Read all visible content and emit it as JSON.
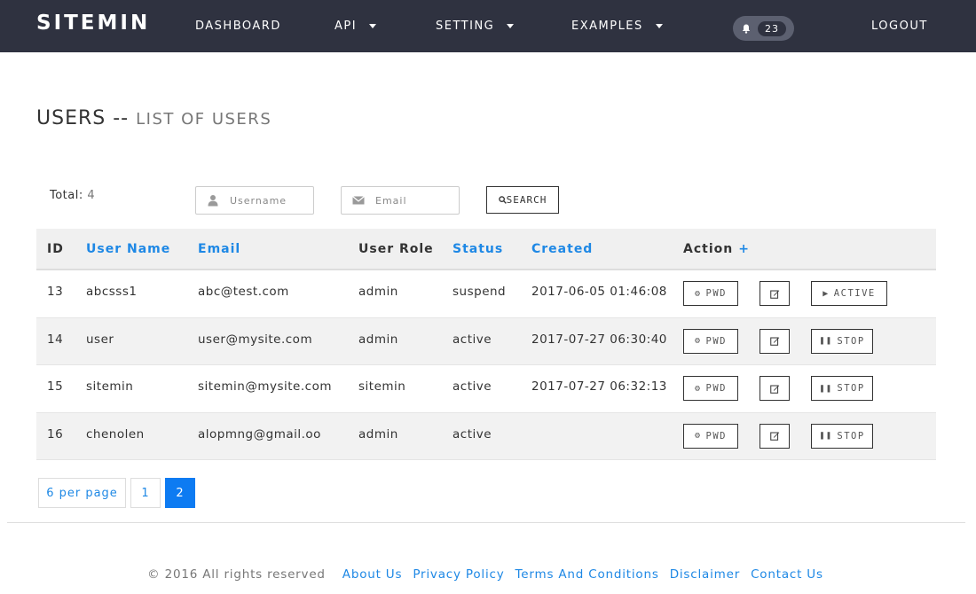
{
  "navbar": {
    "brand": "SITEMIN",
    "items": [
      {
        "label": "DASHBOARD",
        "dropdown": false
      },
      {
        "label": "API",
        "dropdown": true
      },
      {
        "label": "SETTING",
        "dropdown": true
      },
      {
        "label": "EXAMPLES",
        "dropdown": true
      }
    ],
    "notification_count": "23",
    "logout_label": "LOGOUT",
    "bg_color": "#2f3240"
  },
  "page": {
    "title": "USERS",
    "separator": "--",
    "subtitle": "LIST OF USERS"
  },
  "filters": {
    "total_label": "Total:",
    "total_value": "4",
    "username_placeholder": "Username",
    "email_placeholder": "Email",
    "search_label": "SEARCH"
  },
  "table": {
    "headers": {
      "id": "ID",
      "username": "User Name",
      "email": "Email",
      "role": "User Role",
      "status": "Status",
      "created": "Created",
      "action": "Action",
      "action_add": "+"
    },
    "rows": [
      {
        "id": "13",
        "username": "abcsss1",
        "email": "abc@test.com",
        "role": "admin",
        "status": "suspend",
        "created": "2017-06-05 01:46:08",
        "pwd_label": "PWD",
        "state_label": "ACTIVE",
        "state_icon": "play-icon"
      },
      {
        "id": "14",
        "username": "user",
        "email": "user@mysite.com",
        "role": "admin",
        "status": "active",
        "created": "2017-07-27 06:30:40",
        "pwd_label": "PWD",
        "state_label": "STOP",
        "state_icon": "pause-icon"
      },
      {
        "id": "15",
        "username": "sitemin",
        "email": "sitemin@mysite.com",
        "role": "sitemin",
        "status": "active",
        "created": "2017-07-27 06:32:13",
        "pwd_label": "PWD",
        "state_label": "STOP",
        "state_icon": "pause-icon"
      },
      {
        "id": "16",
        "username": "chenolen",
        "email": "alopmng@gmail.oo",
        "role": "admin",
        "status": "active",
        "created": "",
        "pwd_label": "PWD",
        "state_label": "STOP",
        "state_icon": "pause-icon"
      }
    ]
  },
  "pagination": {
    "per_page_label": "6 per page",
    "pages": [
      "1",
      "2"
    ],
    "current_page": "2",
    "active_color": "#0d7bf2"
  },
  "footer": {
    "copyright": "© 2016 All rights reserved",
    "links": [
      "About Us",
      "Privacy Policy",
      "Terms And Conditions",
      "Disclaimer",
      "Contact Us"
    ]
  },
  "colors": {
    "link": "#1e88e5",
    "row_alt": "#f2f2f2"
  }
}
